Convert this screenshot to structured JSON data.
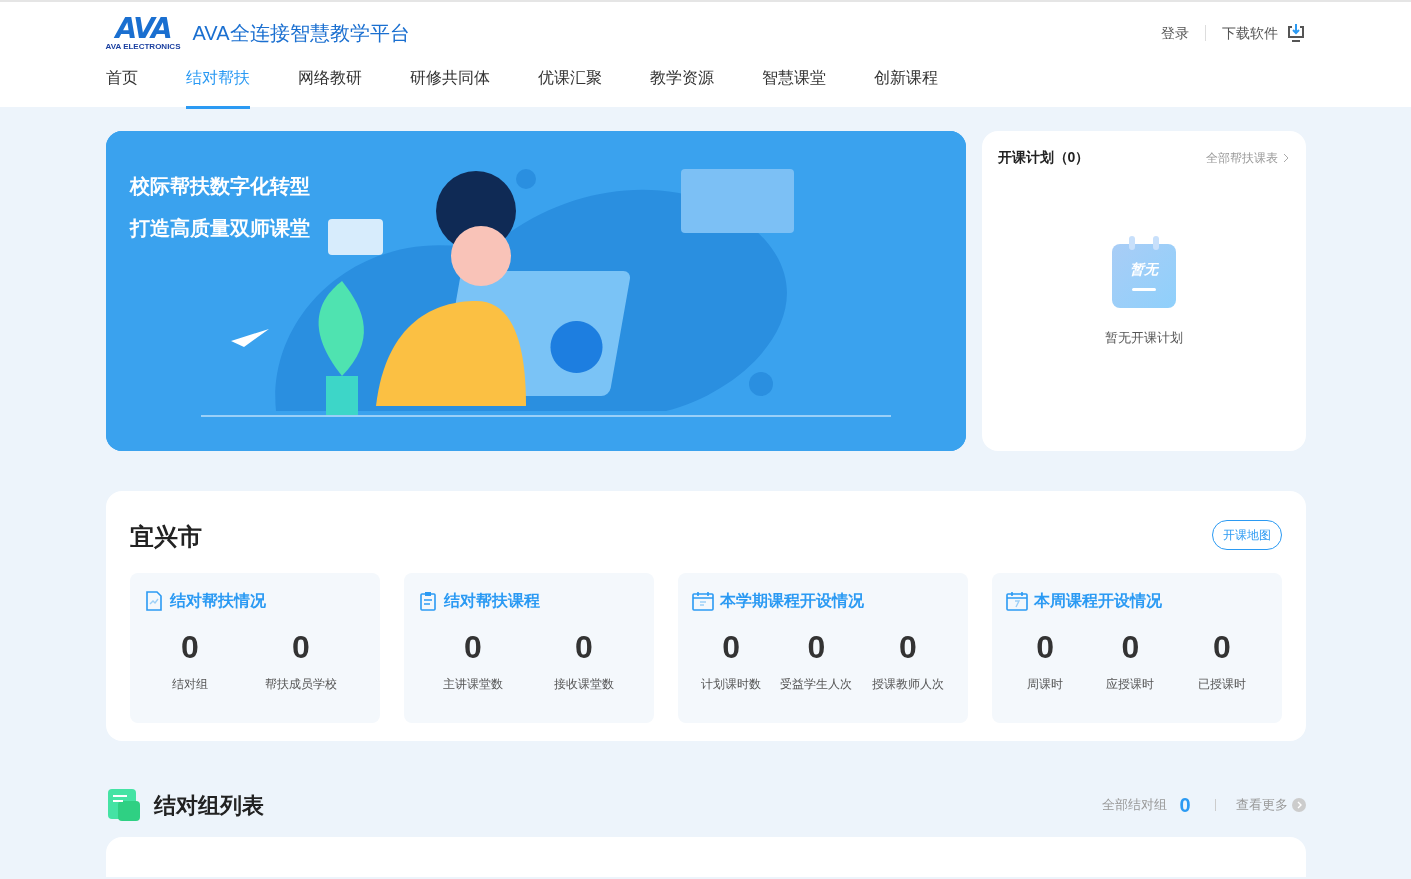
{
  "header": {
    "logo": {
      "mark": "AVA",
      "sub": "AVA ELECTRONICS"
    },
    "site_title": "AVA全连接智慧教学平台",
    "login": "登录",
    "download": "下载软件"
  },
  "nav": [
    {
      "label": "首页",
      "selected": false
    },
    {
      "label": "结对帮扶",
      "selected": true
    },
    {
      "label": "网络教研",
      "selected": false
    },
    {
      "label": "研修共同体",
      "selected": false
    },
    {
      "label": "优课汇聚",
      "selected": false
    },
    {
      "label": "教学资源",
      "selected": false
    },
    {
      "label": "智慧课堂",
      "selected": false
    },
    {
      "label": "创新课程",
      "selected": false
    }
  ],
  "banner": {
    "lines": [
      "校际帮扶数字化转型",
      "打造高质量双师课堂"
    ]
  },
  "plan": {
    "title": "开课计划（0）",
    "link": "全部帮扶课表",
    "empty_icon_text": "暂无",
    "empty_text": "暂无开课计划"
  },
  "region": {
    "title": "宜兴市",
    "map_button": "开课地图",
    "cards": [
      {
        "kind": "chart",
        "title": "结对帮扶情况",
        "stats": [
          {
            "value": "0",
            "label": "结对组"
          },
          {
            "value": "0",
            "label": "帮扶成员学校"
          }
        ]
      },
      {
        "kind": "clipboard",
        "title": "结对帮扶课程",
        "stats": [
          {
            "value": "0",
            "label": "主讲课堂数"
          },
          {
            "value": "0",
            "label": "接收课堂数"
          }
        ]
      },
      {
        "kind": "calendar",
        "title": "本学期课程开设情况",
        "stats": [
          {
            "value": "0",
            "label": "计划课时数"
          },
          {
            "value": "0",
            "label": "受益学生人次"
          },
          {
            "value": "0",
            "label": "授课教师人次"
          }
        ]
      },
      {
        "kind": "week",
        "title": "本周课程开设情况",
        "stats": [
          {
            "value": "0",
            "label": "周课时"
          },
          {
            "value": "0",
            "label": "应授课时"
          },
          {
            "value": "0",
            "label": "已授课时"
          }
        ]
      }
    ]
  },
  "pairs": {
    "title": "结对组列表",
    "total_label": "全部结对组",
    "total": "0",
    "more": "查看更多"
  }
}
